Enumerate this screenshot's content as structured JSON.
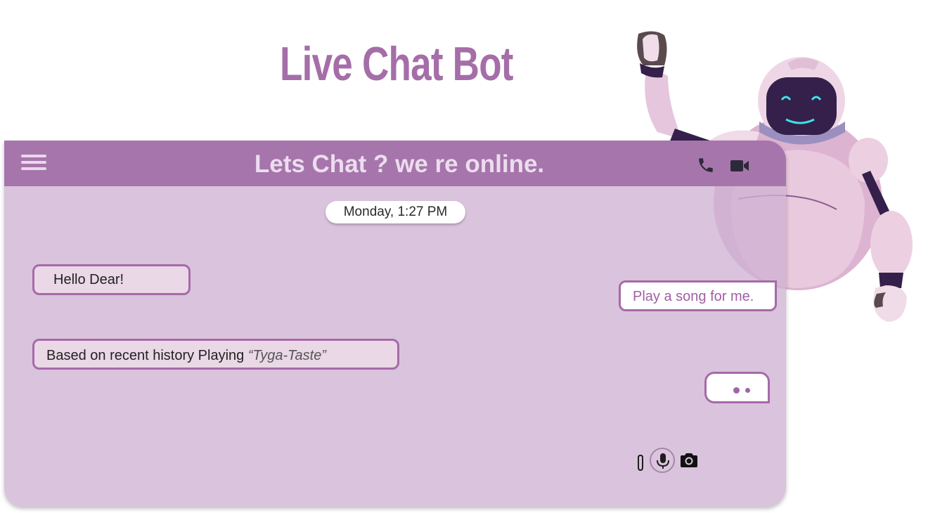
{
  "page": {
    "title": "Live Chat Bot"
  },
  "header": {
    "title": "Lets Chat ? we re online.",
    "menu_icon": "hamburger-menu-icon",
    "call_icon": "phone-icon",
    "video_icon": "video-camera-icon"
  },
  "chat": {
    "date_label": "Monday, 1:27 PM",
    "messages": [
      {
        "sender": "bot",
        "text": "Hello Dear!"
      },
      {
        "sender": "user",
        "text": "Play a song for me."
      },
      {
        "sender": "bot",
        "text": "Based on recent history Playing ",
        "song": "“Tyga-Taste”"
      }
    ],
    "typing_indicator": true
  },
  "composer": {
    "attach_icon": "paperclip-icon",
    "mic_icon": "microphone-icon",
    "camera_icon": "camera-icon"
  },
  "colors": {
    "brand": "#a675ab",
    "chat_background": "#d6bfd9",
    "bubble_border": "#a66aa9",
    "header_text": "#ecdcef"
  }
}
